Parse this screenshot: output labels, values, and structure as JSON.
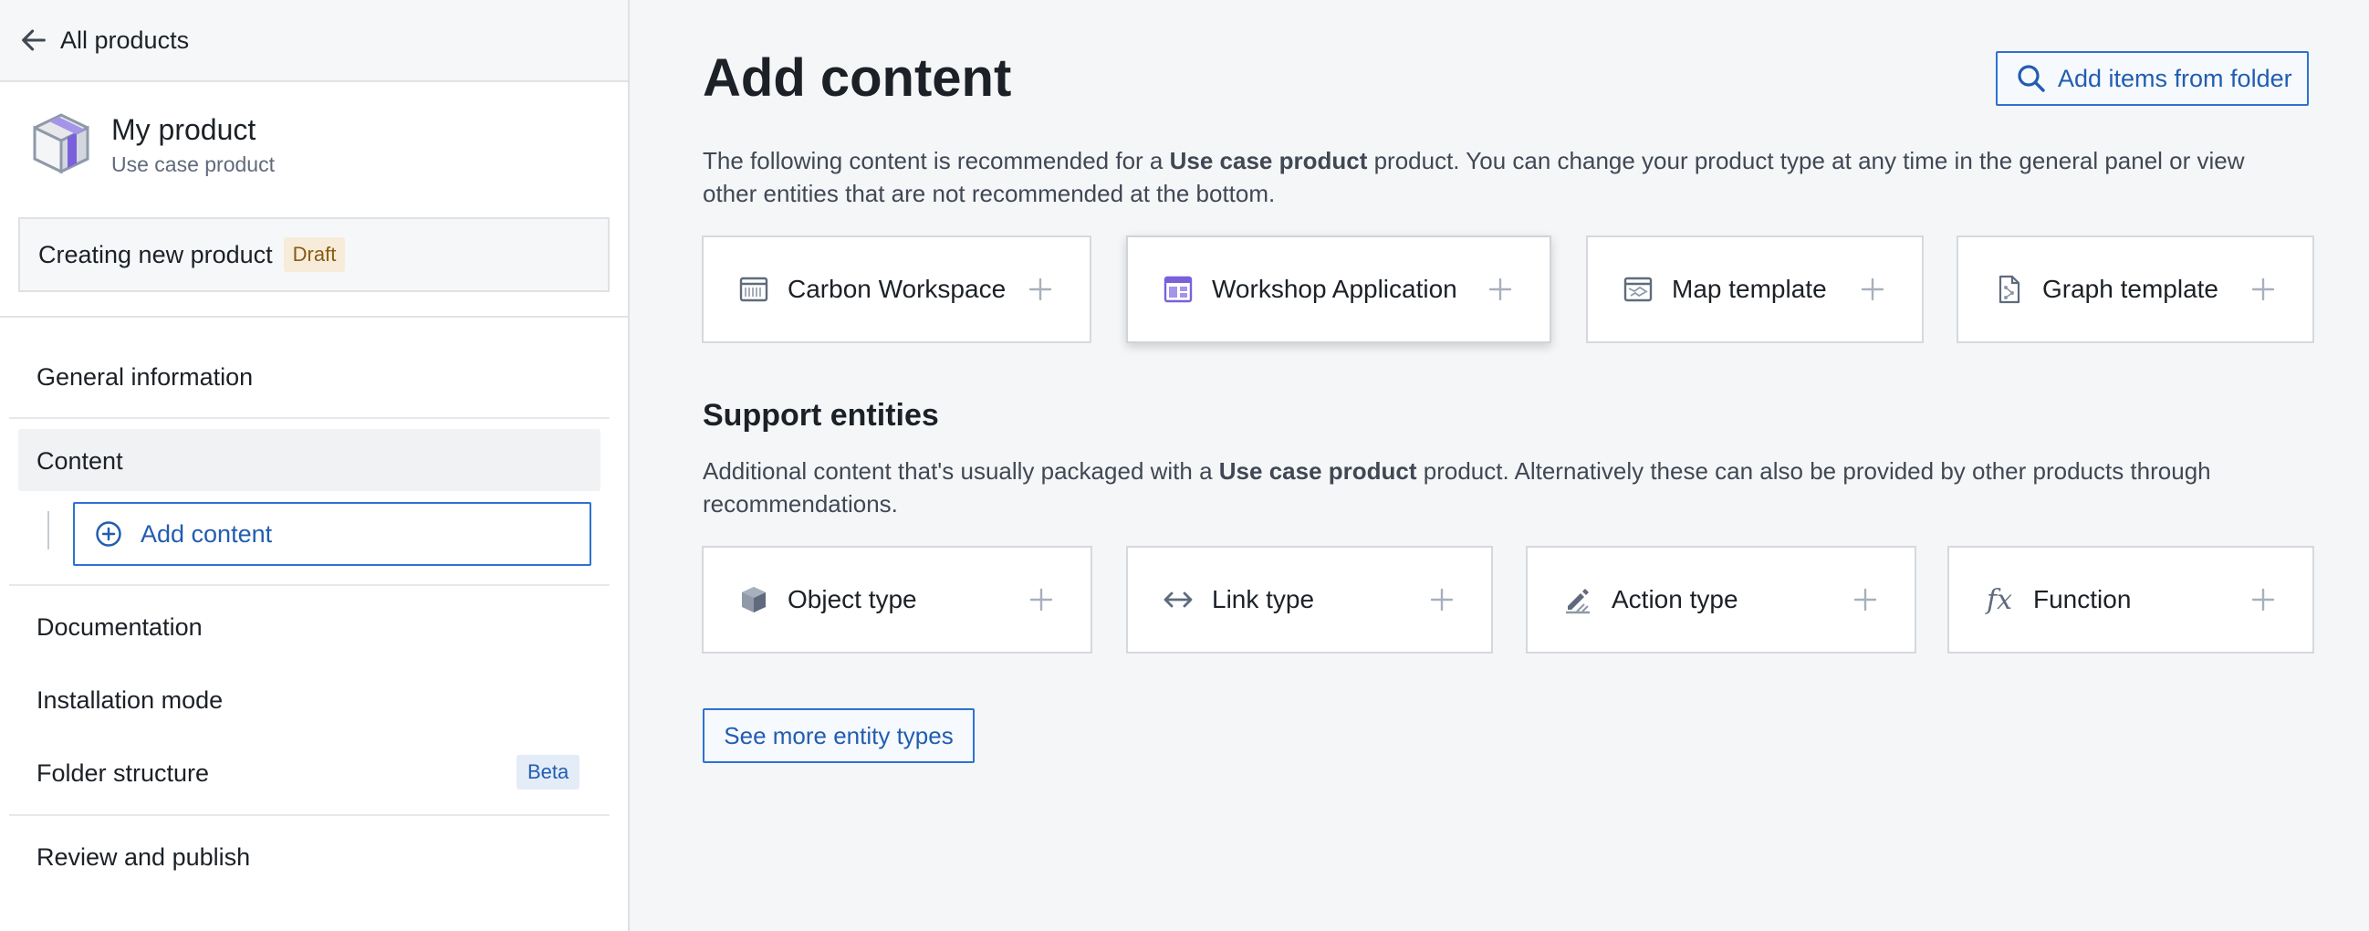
{
  "sidebar": {
    "back_label": "All products",
    "product_name": "My product",
    "product_type": "Use case product",
    "status_text": "Creating new product",
    "status_badge": "Draft",
    "nav": {
      "general": "General information",
      "content": "Content",
      "add_content": "Add content",
      "documentation": "Documentation",
      "installation": "Installation mode",
      "folder": "Folder structure",
      "folder_badge": "Beta",
      "review": "Review and publish"
    }
  },
  "main": {
    "title": "Add content",
    "add_folder_label": "Add items from folder",
    "recommended_desc": {
      "pre": "The following content is recommended for a ",
      "bold": "Use case product",
      "post_line1": " product. You can change your product type at any time in the general panel or view",
      "line2": "other entities that are not recommended at the bottom."
    },
    "recommended_cards": [
      {
        "label": "Carbon Workspace",
        "icon": "carbon-workspace-icon"
      },
      {
        "label": "Workshop Application",
        "icon": "workshop-icon"
      },
      {
        "label": "Map template",
        "icon": "map-icon"
      },
      {
        "label": "Graph template",
        "icon": "graph-icon"
      }
    ],
    "support_title": "Support entities",
    "support_desc": {
      "pre": "Additional content that's usually packaged with a ",
      "bold": "Use case product",
      "post_line1": " product. Alternatively these can also be provided by other products through",
      "line2": "recommendations."
    },
    "support_cards": [
      {
        "label": "Object type",
        "icon": "cube-icon"
      },
      {
        "label": "Link type",
        "icon": "link-arrows-icon"
      },
      {
        "label": "Action type",
        "icon": "action-icon"
      },
      {
        "label": "Function",
        "icon": "function-icon",
        "glyph": "fx"
      }
    ],
    "see_more_label": "See more entity types"
  },
  "colors": {
    "accent": "#2d72d2",
    "accent_text": "#215db0",
    "draft_bg": "#f7ecd9",
    "draft_text": "#8a5a12",
    "beta_bg": "#e4ecf8",
    "workshop_icon": "#7961db"
  }
}
